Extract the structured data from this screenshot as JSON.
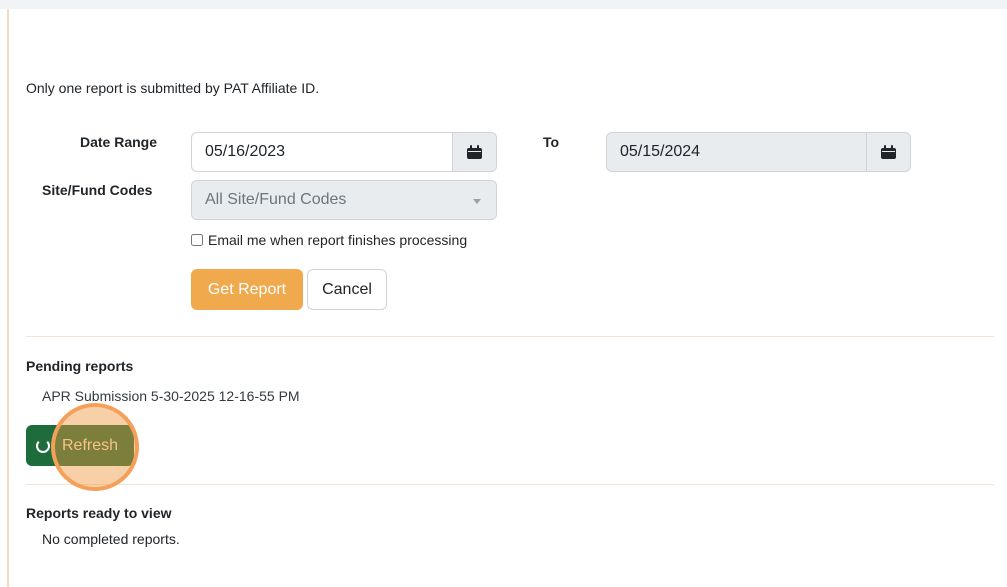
{
  "form": {
    "note": "Only one report is submitted by PAT Affiliate ID.",
    "date_range_label": "Date Range",
    "from_date": "05/16/2023",
    "to_label": "To",
    "to_date": "05/15/2024",
    "site_fund_label": "Site/Fund Codes",
    "site_fund_value": "All Site/Fund Codes",
    "email_checkbox_label": "Email me when report finishes processing",
    "email_checked": false,
    "get_report_label": "Get Report",
    "cancel_label": "Cancel"
  },
  "pending": {
    "title": "Pending reports",
    "items": [
      "APR Submission 5-30-2025 12-16-55 PM"
    ],
    "refresh_label": "Refresh"
  },
  "ready": {
    "title": "Reports ready to view",
    "empty_message": "No completed reports."
  },
  "icons": {
    "date_picker": "calendar-icon",
    "dropdown": "chevron-down-icon",
    "refresh": "refresh-icon"
  },
  "colors": {
    "primary_button": "#f0a94d",
    "refresh_button": "#1e6b3c",
    "highlight": "#f4a05a"
  }
}
